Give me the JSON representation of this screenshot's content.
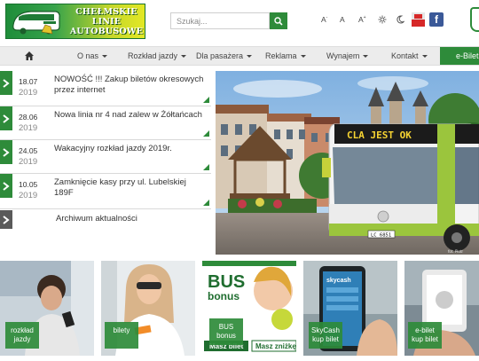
{
  "logo": {
    "lines": [
      "CHEŁMSKIE",
      "LINIE",
      "AUTOBUSOWE"
    ]
  },
  "search": {
    "placeholder": "Szukaj..."
  },
  "accessibility": {
    "font_small": "A",
    "font_normal": "A",
    "font_large": "A"
  },
  "colors": {
    "brand_green": "#2e8b3a",
    "lime": "#c4d62a",
    "facebook": "#3b5998"
  },
  "social": {
    "facebook_letter": "f"
  },
  "nav": {
    "items": [
      {
        "label": "O nas"
      },
      {
        "label": "Rozkład jazdy"
      },
      {
        "label": "Dla pasażera"
      },
      {
        "label": "Reklama"
      },
      {
        "label": "Wynajem"
      },
      {
        "label": "Kontakt"
      }
    ],
    "ebilet": "e-Bilet"
  },
  "news": {
    "items": [
      {
        "date": "18.07",
        "year": "2019",
        "title": "NOWOŚĆ !!! Zakup biletów okresowych przez internet"
      },
      {
        "date": "28.06",
        "year": "2019",
        "title": "Nowa linia nr 4 nad zalew w Żółtańcach"
      },
      {
        "date": "24.05",
        "year": "2019",
        "title": "Wakacyjny rozkład jazdy 2019r."
      },
      {
        "date": "10.05",
        "year": "2019",
        "title": "Zamknięcie kasy przy ul. Lubelskiej 189F"
      }
    ],
    "archive": "Archiwum aktualności"
  },
  "hero": {
    "bus_sign": "CLA JEST OK",
    "plate": "LC 6851",
    "credit": "fot. Piotr"
  },
  "tiles": [
    {
      "label": "rozkład\njazdy"
    },
    {
      "label": "bilety"
    },
    {
      "label": "BUS\nbonus",
      "poster_top": "BUS",
      "poster_bottom": "bonus",
      "poster_ribbon": "Masz bilet",
      "poster_ribbon2": "Masz zniżkę"
    },
    {
      "label": "SkyCash\nkup bilet",
      "phone_brand": "skycash"
    },
    {
      "label": "e-bilet\nkup bilet"
    }
  ]
}
